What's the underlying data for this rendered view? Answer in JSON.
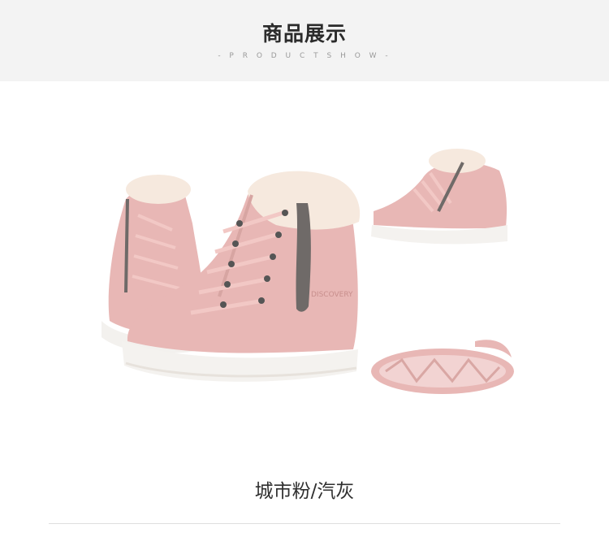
{
  "header": {
    "title": "商品展示",
    "subtitle": "- P R O D U C T S H O W -"
  },
  "product": {
    "image_icon": "pink-sneaker-boots-image",
    "caption": "城市粉/汽灰",
    "colors": {
      "suede": "#e8b7b5",
      "sole": "#f4f2ef",
      "fur": "#f5e8da",
      "zipper": "#6f6a68"
    }
  }
}
